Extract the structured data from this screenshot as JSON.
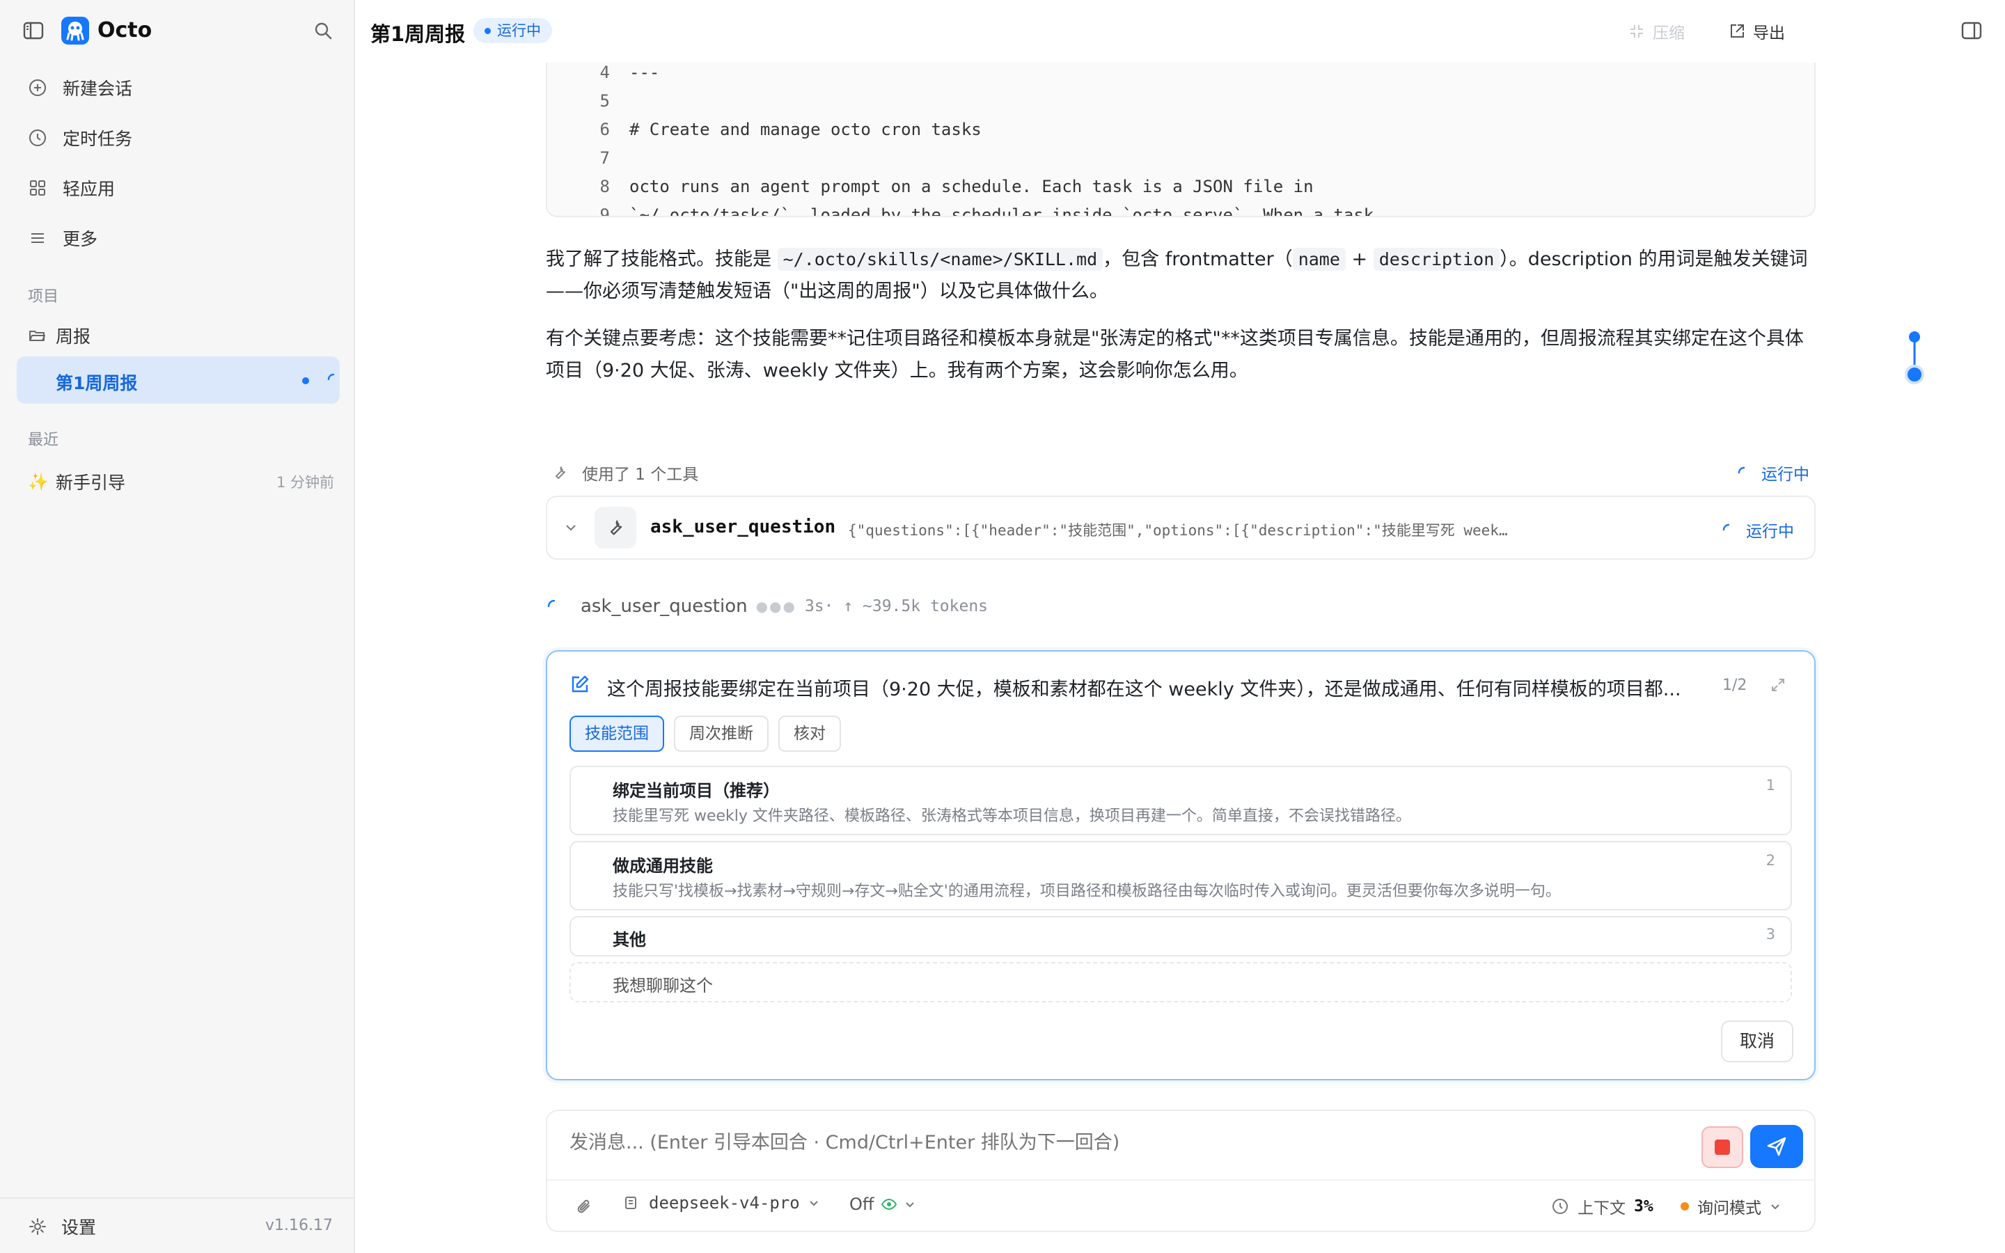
{
  "sidebar": {
    "app_name": "Octo",
    "nav": [
      {
        "label": "新建会话",
        "icon": "plus-circle-icon"
      },
      {
        "label": "定时任务",
        "icon": "clock-icon"
      },
      {
        "label": "轻应用",
        "icon": "grid-icon"
      },
      {
        "label": "更多",
        "icon": "menu-icon"
      }
    ],
    "projects_label": "项目",
    "project_folder": "周报",
    "active_session": "第1周周报",
    "recent_label": "最近",
    "recent_items": [
      {
        "icon": "✨",
        "label": "新手引导",
        "time": "1 分钟前"
      }
    ],
    "settings_label": "设置",
    "version": "v1.16.17"
  },
  "header": {
    "title": "第1周周报",
    "status": "运行中",
    "compress_label": "压缩",
    "export_label": "导出"
  },
  "code_block": {
    "lines": [
      {
        "num": "4",
        "text": "---"
      },
      {
        "num": "5",
        "text": ""
      },
      {
        "num": "6",
        "text": "# Create and manage octo cron tasks"
      },
      {
        "num": "7",
        "text": ""
      },
      {
        "num": "8",
        "text": "octo runs an agent prompt on a schedule. Each task is a JSON file in"
      },
      {
        "num": "9",
        "text": "`~/.octo/tasks/`, loaded by the scheduler inside `octo serve`. When a task"
      }
    ]
  },
  "message": {
    "p1_a": "我了解了技能格式。技能是 ",
    "p1_code1": "~/.octo/skills/<name>/SKILL.md",
    "p1_b": "，包含 frontmatter（",
    "p1_code2": "name",
    "p1_c": " + ",
    "p1_code3": "description",
    "p1_d": "）。description 的用词是触发关键词——你必须写清楚触发短语（\"出这周的周报\"）以及它具体做什么。",
    "p2": "有个关键点要考虑：这个技能需要**记住项目路径和模板本身就是\"张涛定的格式\"**这类项目专属信息。技能是通用的，但周报流程其实绑定在这个具体项目（9·20 大促、张涛、weekly 文件夹）上。我有两个方案，这会影响你怎么用。"
  },
  "tool_usage": {
    "summary": "使用了 1 个工具",
    "status": "运行中",
    "tool_name": "ask_user_question",
    "tool_args": "{\"questions\":[{\"header\":\"技能范围\",\"options\":[{\"description\":\"技能里写死 weekly 文件夹路径、…",
    "tool_status": "运行中",
    "progress_name": "ask_user_question",
    "progress_meta": "3s· ↑ ~39.5k tokens"
  },
  "question": {
    "text": "这个周报技能要绑定在当前项目（9·20 大促，模板和素材都在这个 weekly 文件夹），还是做成通用、任何有同样模板的项目都...",
    "count": "1/2",
    "tabs": [
      "技能范围",
      "周次推断",
      "核对"
    ],
    "options": [
      {
        "title": "绑定当前项目（推荐）",
        "desc": "技能里写死 weekly 文件夹路径、模板路径、张涛格式等本项目信息，换项目再建一个。简单直接，不会误找错路径。",
        "num": "1"
      },
      {
        "title": "做成通用技能",
        "desc": "技能只写'找模板→找素材→守规则→存文→贴全文'的通用流程，项目路径和模板路径由每次临时传入或询问。更灵活但要你每次多说明一句。",
        "num": "2"
      },
      {
        "title": "其他",
        "desc": "",
        "num": "3"
      }
    ],
    "chat_option": "我想聊聊这个",
    "cancel_label": "取消"
  },
  "composer": {
    "placeholder": "发消息... (Enter 引导本回合 · Cmd/Ctrl+Enter 排队为下一回合)",
    "model": "deepseek-v4-pro",
    "thinking": "Off",
    "context_label": "上下文",
    "context_value": "3%",
    "mode": "询问模式"
  },
  "colors": {
    "accent": "#1677ff",
    "accent_bg": "#e6f0ff",
    "stop": "#f04438",
    "mode_dot": "#fa8c16"
  }
}
